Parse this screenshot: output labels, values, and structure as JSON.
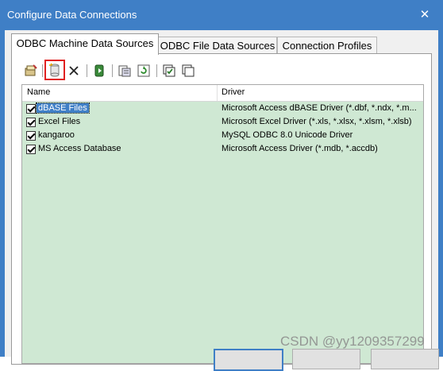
{
  "window": {
    "title": "Configure Data Connections",
    "close_glyph": "✕"
  },
  "tabs": [
    {
      "label": "ODBC Machine Data Sources",
      "active": true
    },
    {
      "label": "ODBC File Data Sources",
      "active": false
    },
    {
      "label": "Connection Profiles",
      "active": false
    }
  ],
  "toolbar": {
    "icons": [
      "configure-dsn-icon",
      "new-dsn-icon",
      "delete-icon",
      "test-connection-icon",
      "import-icon",
      "refresh-icon",
      "select-all-icon",
      "copy-icon"
    ],
    "highlighted": "new-dsn-icon",
    "highlight_color": "#e02020"
  },
  "list": {
    "columns": [
      "Name",
      "Driver"
    ],
    "background": "#cfe8d3",
    "rows": [
      {
        "name": "dBASE Files",
        "driver": "Microsoft Access dBASE Driver (*.dbf, *.ndx, *.m...",
        "checked": true,
        "selected": true
      },
      {
        "name": "Excel Files",
        "driver": "Microsoft Excel Driver (*.xls, *.xlsx, *.xlsm, *.xlsb)",
        "checked": true,
        "selected": false
      },
      {
        "name": "kangaroo",
        "driver": "MySQL ODBC 8.0 Unicode Driver",
        "checked": true,
        "selected": false
      },
      {
        "name": "MS Access Database",
        "driver": "Microsoft Access Driver (*.mdb, *.accdb)",
        "checked": true,
        "selected": false
      }
    ]
  },
  "watermark": "CSDN @yy1209357299",
  "accent": "#3f7fc6"
}
